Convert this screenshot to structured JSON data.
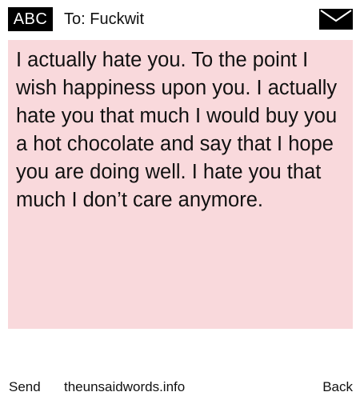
{
  "header": {
    "badge_label": "ABC",
    "recipient": "To: Fuckwit",
    "envelope_icon": "envelope-icon"
  },
  "message": {
    "background_color": "#f9d9dc",
    "text": "I actually hate you. To the point I wish happiness upon you. I actually hate you that much I would buy you a hot chocolate and say that I hope you are doing well. I hate you that much I don’t care anymore."
  },
  "footer": {
    "send_label": "Send",
    "site_label": "theunsaidwords.info",
    "back_label": "Back"
  }
}
